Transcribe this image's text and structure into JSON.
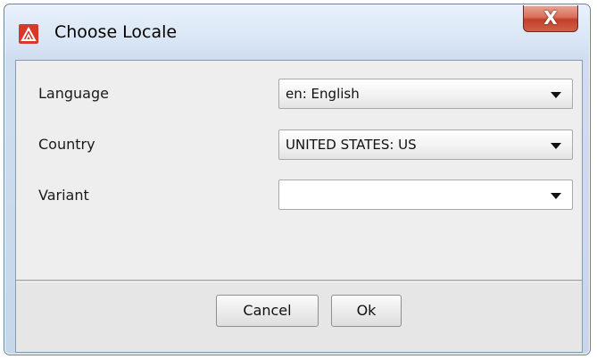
{
  "window": {
    "title": "Choose Locale",
    "close_glyph": "X",
    "icon": "app-logo-icon"
  },
  "form": {
    "language": {
      "label": "Language",
      "value": "en: English"
    },
    "country": {
      "label": "Country",
      "value": "UNITED STATES: US"
    },
    "variant": {
      "label": "Variant",
      "value": ""
    }
  },
  "buttons": {
    "cancel": "Cancel",
    "ok": "Ok"
  },
  "colors": {
    "close_button": "#c2402a",
    "app_icon": "#d8392b"
  }
}
